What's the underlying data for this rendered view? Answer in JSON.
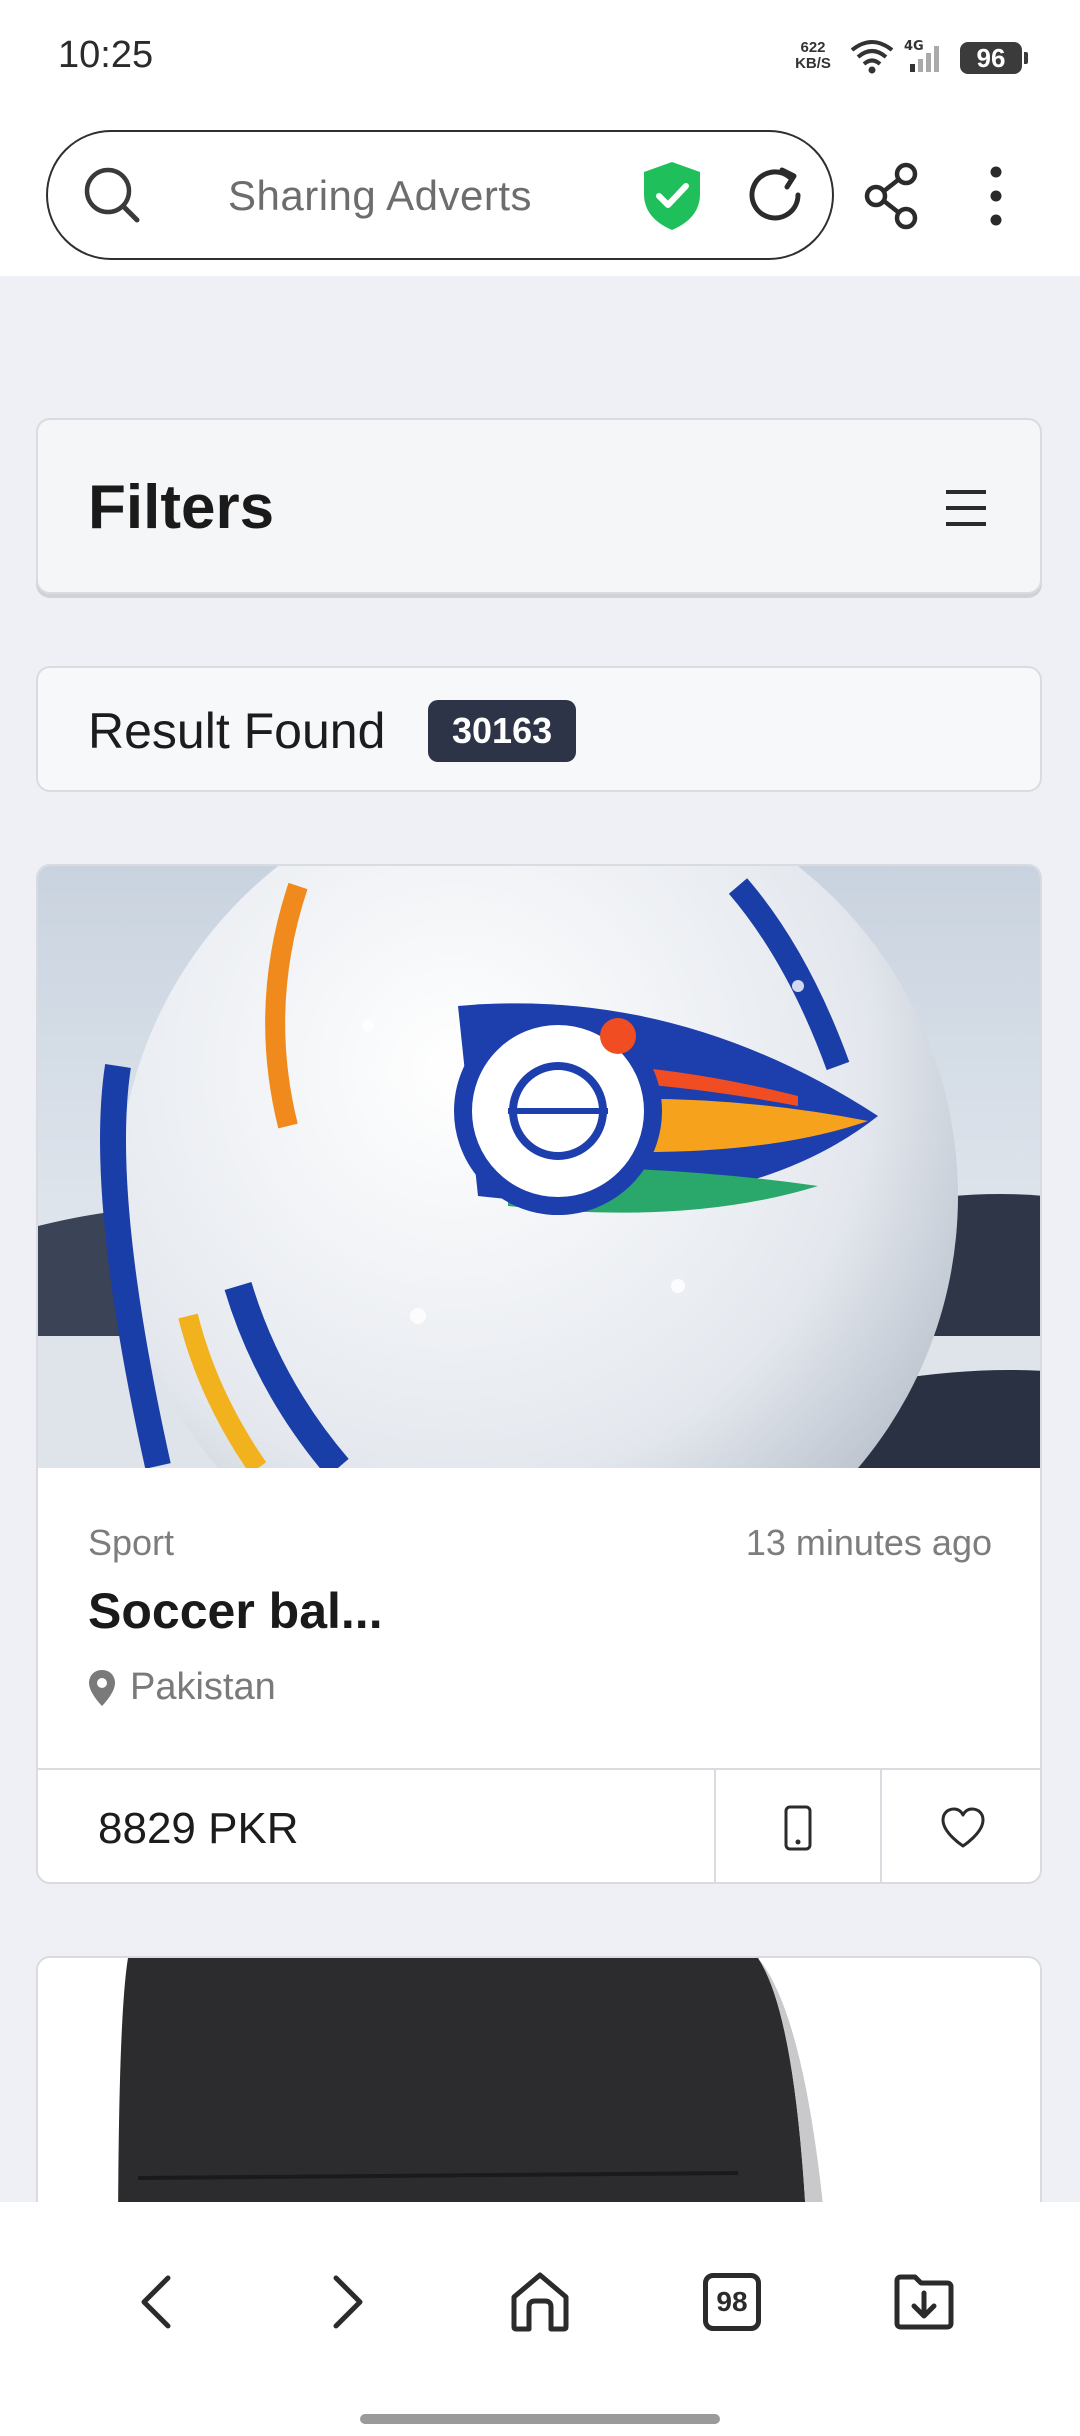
{
  "status_bar": {
    "time": "10:25",
    "net_speed_value": "622",
    "net_speed_unit": "KB/S",
    "network_type": "4G",
    "battery": "96"
  },
  "browser": {
    "url_text": "Sharing Adverts",
    "tabs_count": "98"
  },
  "filters": {
    "title": "Filters"
  },
  "results": {
    "label": "Result Found",
    "count": "30163"
  },
  "listing": {
    "category": "Sport",
    "time_ago": "13 minutes ago",
    "title": "Soccer bal...",
    "location": "Pakistan",
    "price": "8829 PKR"
  },
  "colors": {
    "shield_green": "#1fbf5b",
    "badge_bg": "#2e3447",
    "page_bg": "#eef0f5"
  }
}
